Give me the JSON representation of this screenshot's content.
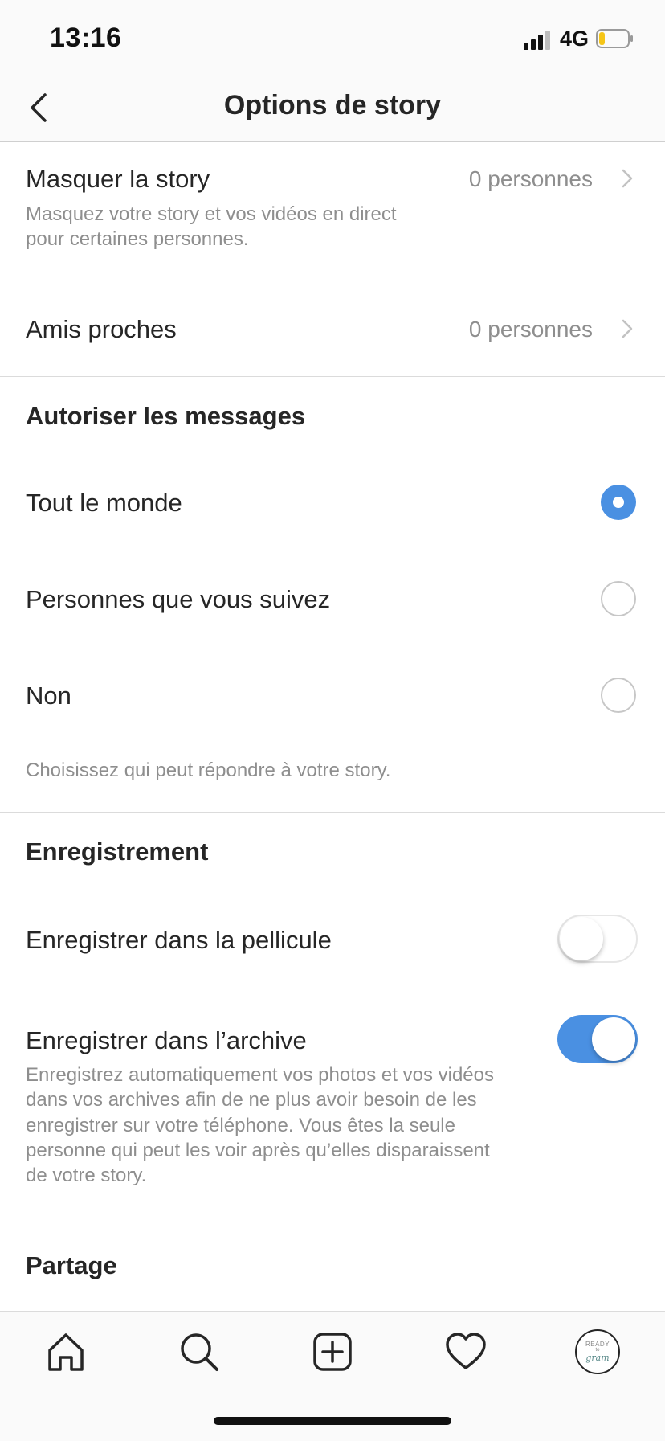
{
  "status_bar": {
    "time": "13:16",
    "network": "4G",
    "icons": [
      "cellular-signal-icon",
      "battery-icon"
    ],
    "battery_color": "#f5c518"
  },
  "nav": {
    "title": "Options de story",
    "back_icon": "chevron-left-icon"
  },
  "hide_story": {
    "title": "Masquer la story",
    "subtitle_line1": "Masquez votre story et vos vidéos en direct",
    "subtitle_line2": "pour certaines personnes.",
    "value": "0 personnes"
  },
  "close_friends": {
    "title": "Amis proches",
    "value": "0 personnes"
  },
  "messages": {
    "heading": "Autoriser les messages",
    "options": [
      {
        "label": "Tout le monde",
        "selected": true
      },
      {
        "label": "Personnes que vous suivez",
        "selected": false
      },
      {
        "label": "Non",
        "selected": false
      }
    ],
    "hint": "Choisissez qui peut répondre à votre story."
  },
  "saving": {
    "heading": "Enregistrement",
    "camera_roll": {
      "label": "Enregistrer dans la pellicule",
      "on": false
    },
    "archive": {
      "label": "Enregistrer dans l’archive",
      "on": true,
      "desc_lines": [
        "Enregistrez automatiquement vos photos et vos vidéos",
        "dans vos archives afin de ne plus avoir besoin de les",
        "enregistrer sur votre téléphone. Vous êtes la seule",
        "personne qui peut les voir après qu’elles disparaissent",
        "de votre story."
      ]
    }
  },
  "sharing": {
    "heading": "Partage"
  },
  "tabbar": {
    "tabs": [
      "home-icon",
      "search-icon",
      "add-post-icon",
      "heart-icon",
      "profile-avatar"
    ],
    "avatar_text": {
      "line1": "READY",
      "line2": "to",
      "line3": "gram"
    }
  },
  "colors": {
    "accent": "#4a90e2",
    "text": "#262626",
    "secondary": "#8e8e8e",
    "divider": "#dbdbdb"
  }
}
